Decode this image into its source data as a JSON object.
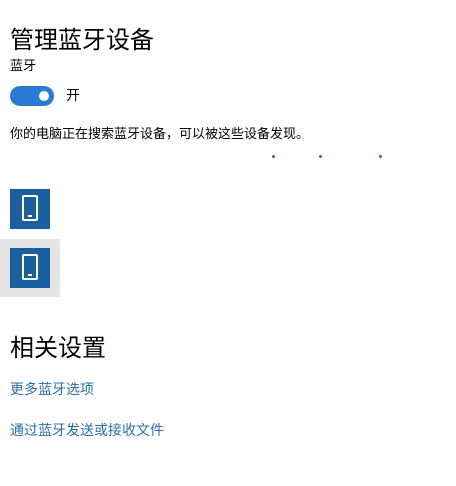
{
  "page_title": "管理蓝牙设备",
  "bluetooth": {
    "label": "蓝牙",
    "toggle_on": true,
    "toggle_state_text": "开",
    "accent_color": "#2b7bd3"
  },
  "search_status": "你的电脑正在搜索蓝牙设备，可以被这些设备发现。",
  "devices": [
    {
      "icon": "phone-icon",
      "tile_color": "#1c5f9f"
    },
    {
      "icon": "phone-icon",
      "tile_color": "#1c5f9f",
      "selected": true
    }
  ],
  "related": {
    "title": "相关设置",
    "links": [
      {
        "label": "更多蓝牙选项"
      },
      {
        "label": "通过蓝牙发送或接收文件"
      }
    ],
    "link_color": "#2b6ea8"
  }
}
